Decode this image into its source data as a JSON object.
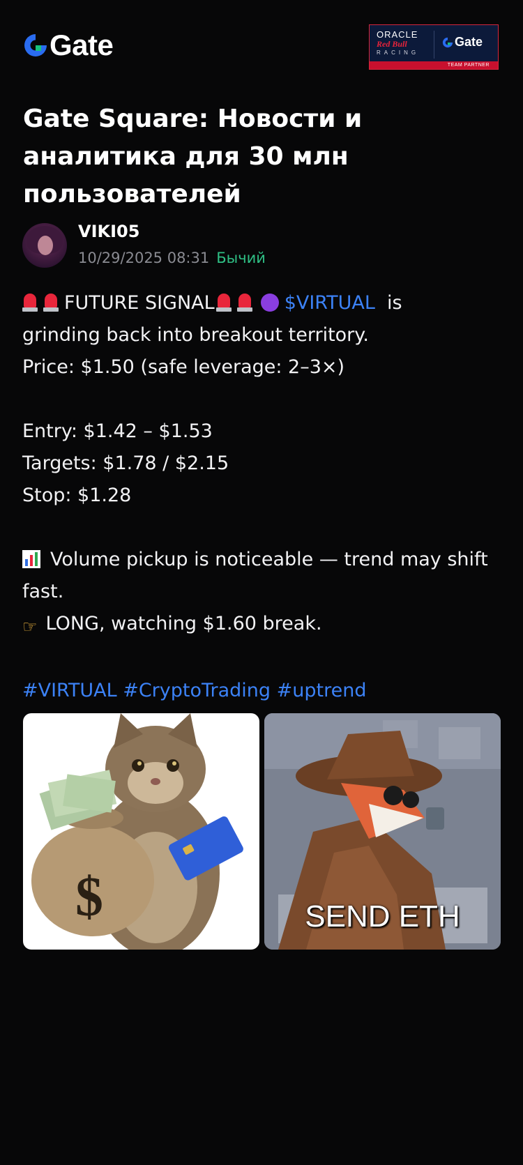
{
  "header": {
    "logo_text": "Gate",
    "partner": {
      "oracle": "ORACLE",
      "redbull": "Red Bull",
      "racing": "RACING",
      "gate": "Gate",
      "team_partner": "TEAM PARTNER"
    }
  },
  "headline": "Gate Square: Новости и аналитика для 30 млн пользователей",
  "author": {
    "name": "VIKI05",
    "date": "10/29/2025 08:31",
    "sentiment": "Бычий"
  },
  "post": {
    "signal_label": "FUTURE SIGNAL",
    "ticker": "$VIRTUAL",
    "line1_tail": "is",
    "line2": "grinding back into breakout territory.",
    "line3": "Price: $1.50 (safe leverage: 2–3×)",
    "entry": "Entry: $1.42 – $1.53",
    "targets": "Targets: $1.78 / $2.15",
    "stop": "Stop: $1.28",
    "volume": "Volume pickup is noticeable — trend may shift fast.",
    "long": "LONG, watching $1.60 break.",
    "hashtags": "#VIRTUAL #CryptoTrading #uptrend"
  },
  "images": {
    "right_caption": "SEND ETH"
  }
}
